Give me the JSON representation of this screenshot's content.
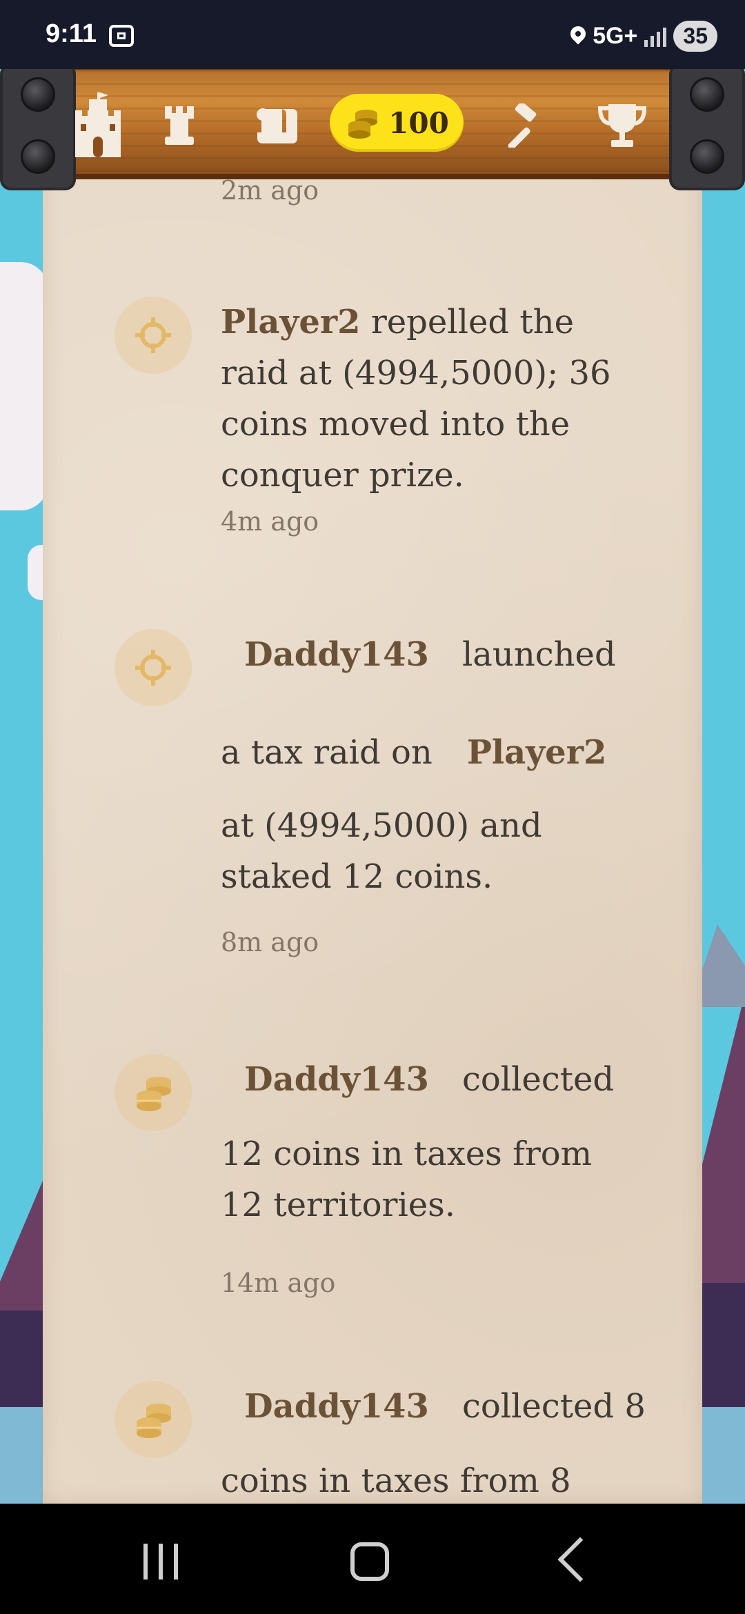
{
  "status_bar": {
    "time": "9:11",
    "network": "5G+",
    "battery": "35"
  },
  "top_bar": {
    "coins": "100",
    "icons": [
      "castle-icon",
      "rook-icon",
      "scroll-icon",
      "coins-icon",
      "hammer-icon",
      "trophy-icon"
    ]
  },
  "feed": {
    "partial_top_time": "2m ago",
    "entries": [
      {
        "icon": "crosshair-icon",
        "actor": "Player2",
        "lines": [
          "repelled the",
          "raid at (4994,5000); 36",
          "coins moved into the",
          "conquer prize."
        ],
        "time": "4m ago"
      },
      {
        "icon": "crosshair-icon",
        "actor": "Daddy143",
        "verb": "launched",
        "line2_prefix": "a tax raid on",
        "target": "Player2",
        "lines": [
          "at (4994,5000) and",
          "staked 12 coins."
        ],
        "time": "8m ago"
      },
      {
        "icon": "coins-icon",
        "actor": "Daddy143",
        "verb": "collected",
        "lines": [
          "12 coins in taxes from",
          "12 territories."
        ],
        "time": "14m ago"
      },
      {
        "icon": "coins-icon",
        "actor": "Daddy143",
        "verb": "collected 8",
        "lines": [
          "coins in taxes from 8"
        ]
      }
    ]
  },
  "colors": {
    "parchment": "#e7d8c6",
    "wood": "#b8742d",
    "coin_pill": "#fde21a",
    "actor_text": "#6b5237",
    "sky": "#5cc8e0"
  }
}
